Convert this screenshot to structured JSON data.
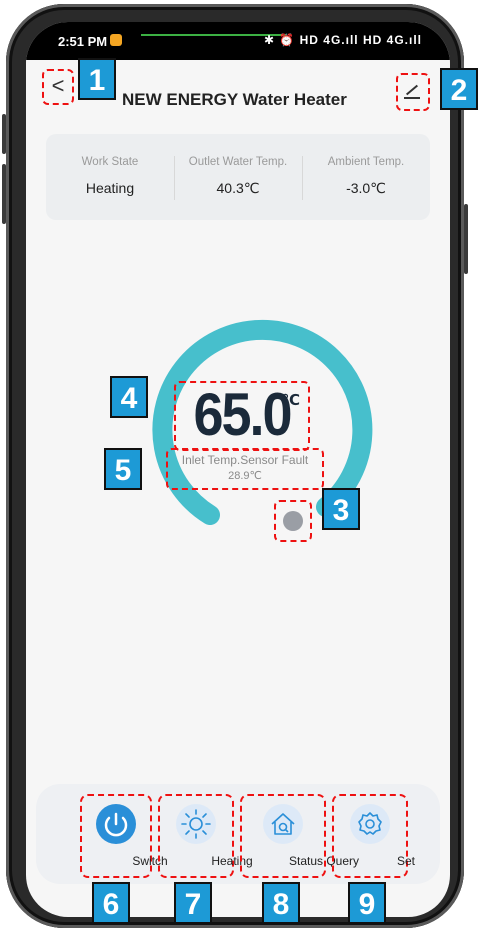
{
  "status_bar": {
    "time": "2:51 PM",
    "right_icons": "✱ ⏰ HD 4G.ıll HD 4G.ıll"
  },
  "header": {
    "back_glyph": "<",
    "title": "NEW ENERGY Water Heater"
  },
  "info": [
    {
      "label": "Work State",
      "value": "Heating"
    },
    {
      "label": "Outlet Water Temp.",
      "value": "40.3℃"
    },
    {
      "label": "Ambient Temp.",
      "value": "-3.0℃"
    }
  ],
  "gauge": {
    "set_temp": "65.0",
    "unit": "℃",
    "fault_text": "Inlet Temp.Sensor Fault",
    "fault_value": "28.9℃",
    "arc_color": "#47bfcc"
  },
  "nav": [
    {
      "label": "Switch",
      "icon": "power-icon"
    },
    {
      "label": "Heating",
      "icon": "sun-icon"
    },
    {
      "label": "Status Query",
      "icon": "house-search-icon"
    },
    {
      "label": "Set",
      "icon": "gear-icon"
    }
  ],
  "badges": [
    "1",
    "2",
    "3",
    "4",
    "5",
    "6",
    "7",
    "8",
    "9"
  ],
  "colors": {
    "accent": "#1d9ad6",
    "annotation": "#e11111",
    "arc": "#47bfcc",
    "knob": "#9a9ea5"
  }
}
